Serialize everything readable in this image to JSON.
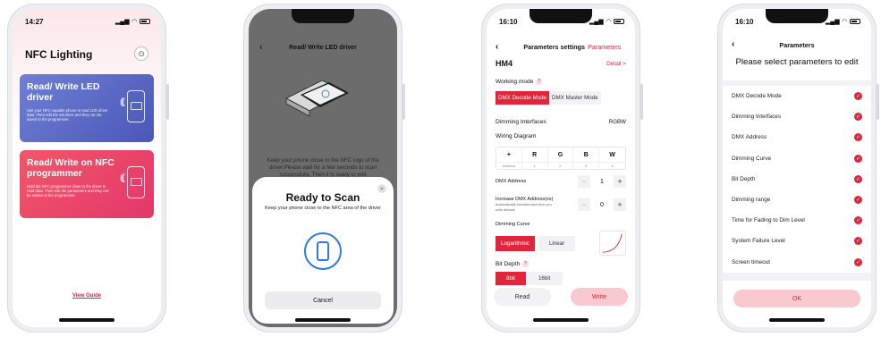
{
  "screen1": {
    "time": "14:27",
    "title": "NFC Lighting",
    "card1": {
      "title": "Read/ Write LED driver",
      "desc": "Use your NFC-capable phone to read LED driver data. Then edit the solutions and they can be saved to the programmer."
    },
    "card2": {
      "title": "Read/ Write on NFC programmer",
      "desc": "Hold the NFC programmer close to the driver to read data. Then edit the parameters and they can be written to the programmer."
    },
    "view_guide": "View Guide"
  },
  "screen2": {
    "title": "Read/ Write LED driver",
    "desc": "Keep your phone close to the NFC logo of the driver.Please wait for a few seconds to scan successfully. Then it is ready to edit",
    "sheet_title": "Ready to Scan",
    "sheet_sub": "Keep your phone close to the NFC area of the driver",
    "cancel": "Cancel"
  },
  "screen3": {
    "time": "16:10",
    "nav_title": "Parameters settings",
    "nav_extra": "Parameters",
    "model": "HM4",
    "detail": "Detail >",
    "working_mode_label": "Working mode",
    "mode_decode": "DMX Decode Mode",
    "mode_master": "DMX Master Mode",
    "dimming_interfaces_label": "Dimming Interfaces",
    "dimming_interfaces_value": "RGBW",
    "wiring_label": "Wiring Diagram",
    "wiring_cols": [
      {
        "top": "+",
        "bottom": "Address"
      },
      {
        "top": "R",
        "bottom": "1"
      },
      {
        "top": "G",
        "bottom": "2"
      },
      {
        "top": "B",
        "bottom": "3"
      },
      {
        "top": "W",
        "bottom": "4"
      }
    ],
    "dmx_address_label": "DMX Address",
    "dmx_address_value": "1",
    "increase_label": "Increase DMX Address(es)",
    "increase_sub": "Automatically increase each time you write devices",
    "increase_value": "0",
    "curve_label": "Dimming Curve",
    "curve_log": "Logarithmic",
    "curve_linear": "Linear",
    "bitdepth_label": "Bit Depth",
    "bit_8": "8bit",
    "bit_16": "16bit",
    "read": "Read",
    "write": "Write",
    "minus": "−",
    "plus": "+"
  },
  "screen4": {
    "time": "16:10",
    "nav_title": "Parameters",
    "prompt": "Please select parameters to edit",
    "items": [
      "DMX Decode Mode",
      "Dimming Interfaces",
      "DMX Address",
      "Dimming Curve",
      "Bit Depth",
      "Dimming range",
      "Time for Fading to Dim Level",
      "System Failure Level",
      "Screen timeout"
    ],
    "ok": "OK"
  },
  "colors": {
    "accent": "#e0263a",
    "accent_light": "#f9c9d0",
    "blue_card": "#5563c4",
    "red_card": "#ec4668"
  }
}
